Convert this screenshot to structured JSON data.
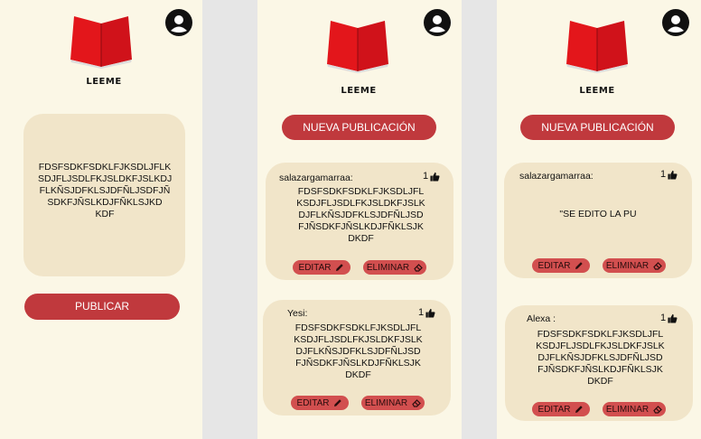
{
  "brand": "LEEME",
  "screen1": {
    "draft_text": "FDSFSDKFSDKLFJKSDLJFLK SDJFLJSDLFKJSLDKFJSLKDJ FLKÑSJDFKLSJDFÑLJSDFJÑ SDKFJÑSLKDJFÑKLSJKD KDF",
    "publish_label": "PUBLICAR"
  },
  "screen2": {
    "new_post_label": "NUEVA PUBLICACIÓN",
    "posts": [
      {
        "author": "salazargamarraa:",
        "likes": "1",
        "text": "FDSFSDKFSDKLFJKSDLJFL KSDJFLJSDLFKJSLDKFJSLK DJFLKÑSJDFKLSJDFÑLJSD FJÑSDKFJÑSLKDJFÑKLSJK DKDF",
        "edit_label": "EDITAR",
        "delete_label": "ELIMINAR"
      },
      {
        "author": "Yesi:",
        "likes": "1",
        "text": "FDSFSDKFSDKLFJKSDLJFL KSDJFLJSDLFKJSLDKFJSLK DJFLKÑSJDFKLSJDFÑLJSD FJÑSDKFJÑSLKDJFÑKLSJK DKDF",
        "edit_label": "EDITAR",
        "delete_label": "ELIMINAR"
      }
    ]
  },
  "screen3": {
    "new_post_label": "NUEVA PUBLICACIÓN",
    "posts": [
      {
        "author": "salazargamarraa:",
        "likes": "1",
        "text": "\"SE EDITO LA PU",
        "edit_label": "EDITAR",
        "delete_label": "ELIMINAR"
      },
      {
        "author": "Alexa :",
        "likes": "1",
        "text": "FDSFSDKFSDKLFJKSDLJFL KSDJFLJSDLFKJSLDKFJSLK DJFLKÑSJDFKLSJDFÑLJSD FJÑSDKFJÑSLKDJFÑKLSJK DKDF",
        "edit_label": "EDITAR",
        "delete_label": "ELIMINAR"
      }
    ]
  },
  "colors": {
    "panel_bg": "#fbf7e6",
    "card_bg": "#f1e5c9",
    "primary_button": "#c0393d",
    "pill_button": "#d24f4f",
    "logo_red": "#e3161b"
  },
  "icons": [
    "book-logo-icon",
    "user-avatar-icon",
    "thumbs-up-icon",
    "pencil-icon",
    "eraser-icon"
  ]
}
